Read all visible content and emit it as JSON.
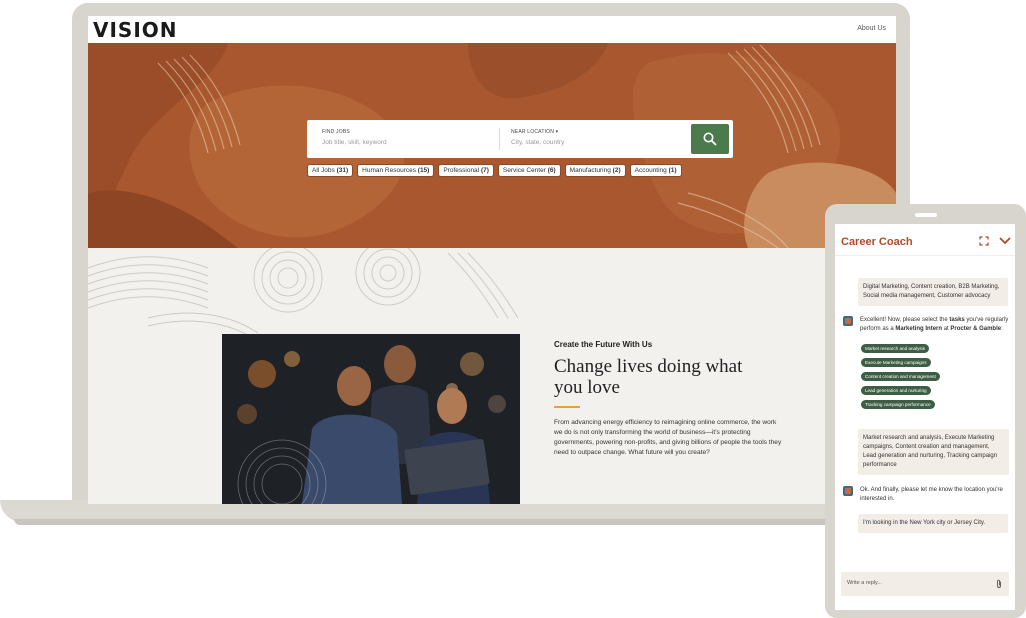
{
  "header": {
    "logo": "VISION",
    "about_link": "About Us"
  },
  "search": {
    "jobs_label": "FIND JOBS",
    "jobs_placeholder": "Job title, skill, keyword",
    "location_label": "NEAR LOCATION ▾",
    "location_placeholder": "City, state, country",
    "button_icon": "search-icon"
  },
  "categories": [
    {
      "label": "All Jobs",
      "count": "(31)"
    },
    {
      "label": "Human Resources",
      "count": "(15)"
    },
    {
      "label": "Professional",
      "count": "(7)"
    },
    {
      "label": "Service Center",
      "count": "(6)"
    },
    {
      "label": "Manufacturing",
      "count": "(2)"
    },
    {
      "label": "Accounting",
      "count": "(1)"
    }
  ],
  "feature": {
    "eyebrow": "Create the Future With Us",
    "headline": "Change lives doing what you love",
    "body": "From advancing energy efficiency to reimagining online commerce, the work we do is not only transforming the world of business—it's protecting governments, powering non-profits, and giving billions of people the tools they need to outpace change. What future will you create?"
  },
  "coach": {
    "title": "Career Coach",
    "messages": [
      {
        "from": "user",
        "text": "Digital Marketing, Content creation, B2B Marketing, Social media management, Customer advocacy"
      },
      {
        "from": "bot",
        "text_pre": "Excellent! Now, please select the ",
        "text_b1": "tasks",
        "text_mid1": " you've regularly perform as a ",
        "text_b2": "Marketing Intern",
        "text_mid2": " at ",
        "text_b3": "Procter & Gamble",
        "text_post": ":"
      },
      {
        "from": "user",
        "text": "Market research and analysis, Execute Marketing campaigns, Content creation and management, Lead generation and nurturing, Tracking campaign performance"
      },
      {
        "from": "bot",
        "text": "Ok. And finally, please let me know the location you're interested in."
      },
      {
        "from": "user",
        "text": "I'm looking in the New York city or Jersey City."
      }
    ],
    "tasks": [
      "Market research and analysis",
      "Execute Marketing campaigns",
      "Content creation and management",
      "Lead generation and nurturing",
      "Tracking campaign performance"
    ],
    "reply_placeholder": "Write a reply..."
  },
  "colors": {
    "hero": "#a9572f",
    "search_button": "#4b7b4d",
    "coach_title": "#b04a2a",
    "task_chip": "#3d5e44",
    "accent": "#e3a53a"
  }
}
